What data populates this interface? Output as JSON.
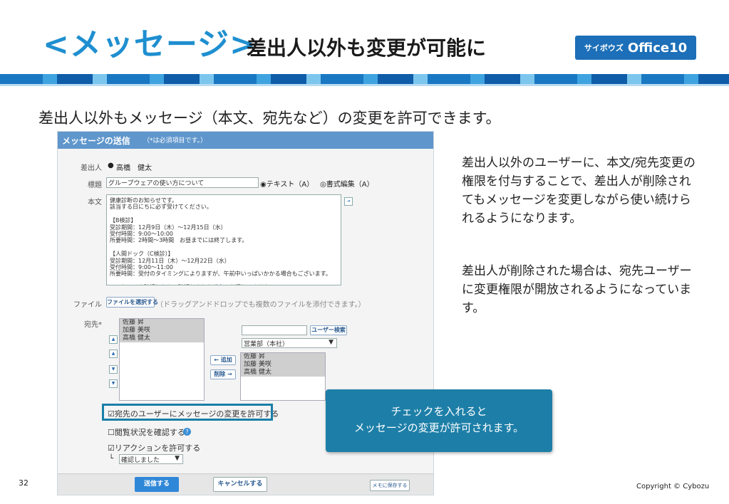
{
  "slide": {
    "title_main": "<メッセージ>",
    "title_sub": "差出人以外も変更が可能に",
    "logo_kana": "サイボウズ",
    "logo_name": "Office10",
    "lead": "差出人以外もメッセージ（本文、宛先など）の変更を許可できます。",
    "right_text_1": "差出人以外のユーザーに、本文/宛先変更の権限を付与することで、差出人が削除されてもメッセージを変更しながら使い続けられるようになります。",
    "right_text_2": "差出人が削除された場合は、宛先ユーザーに変更権限が開放されるようになっています。",
    "callout_line1": "チェックを入れると",
    "callout_line2": "メッセージの変更が許可されます。",
    "page_number": "32",
    "copyright": "Copyright © Cybozu"
  },
  "panel": {
    "header_title": "メッセージの送信",
    "header_note": "（*は必須項目です。）",
    "sender_label": "差出人",
    "sender_value": "高橋　健太",
    "subject_label": "標題",
    "subject_value": "グループウェアの使い方について",
    "format_text": "◉テキスト（A）",
    "format_rich": "◎書式編集（A）",
    "body_label": "本文",
    "body_text": "健康診断のお知らせです。\n該当する日にちに必ず受けてください。\n\n【B検診】\n受診期間：12月9日（木）～12月15日（水）\n受付時間：9:00～10:00\n所要時間：2時間～3時間　お昼までには終了します。\n\n【人間ドック（C検診）】\n受診期間：12月11日（木）～12月22日（水）\n受付時間：9:00～11:00\n所要時間：受付のタイミングによりますが、午前中いっぱいかかる場合もございます。\n\nメッセージを確認したら、確認しましたボタンを押してください。",
    "file_label": "ファイル",
    "file_button": "ファイルを選択する",
    "file_hint": "（ドラッグアンドドロップでも複数のファイルを添付できます。）",
    "dest_label": "宛先*",
    "dest_selected": [
      "佐藤 昇",
      "加藤 美咲",
      "高橋 健太"
    ],
    "add_button": "← 追加",
    "remove_button": "削除 →",
    "user_search_button": "ユーザー検索",
    "group_select": "営業部（本社）",
    "candidates": [
      "佐藤 昇",
      "加藤 美咲",
      "高橋 健太"
    ],
    "allow_change_check": "☑宛先のユーザーにメッセージの変更を許可する",
    "read_status_check": "☐閲覧状況を確認する",
    "reaction_check": "☑リアクションを許可する",
    "reaction_select": "確認しました",
    "send_button": "送信する",
    "cancel_button": "キャンセルする",
    "memo_button": "メモに保存する"
  }
}
